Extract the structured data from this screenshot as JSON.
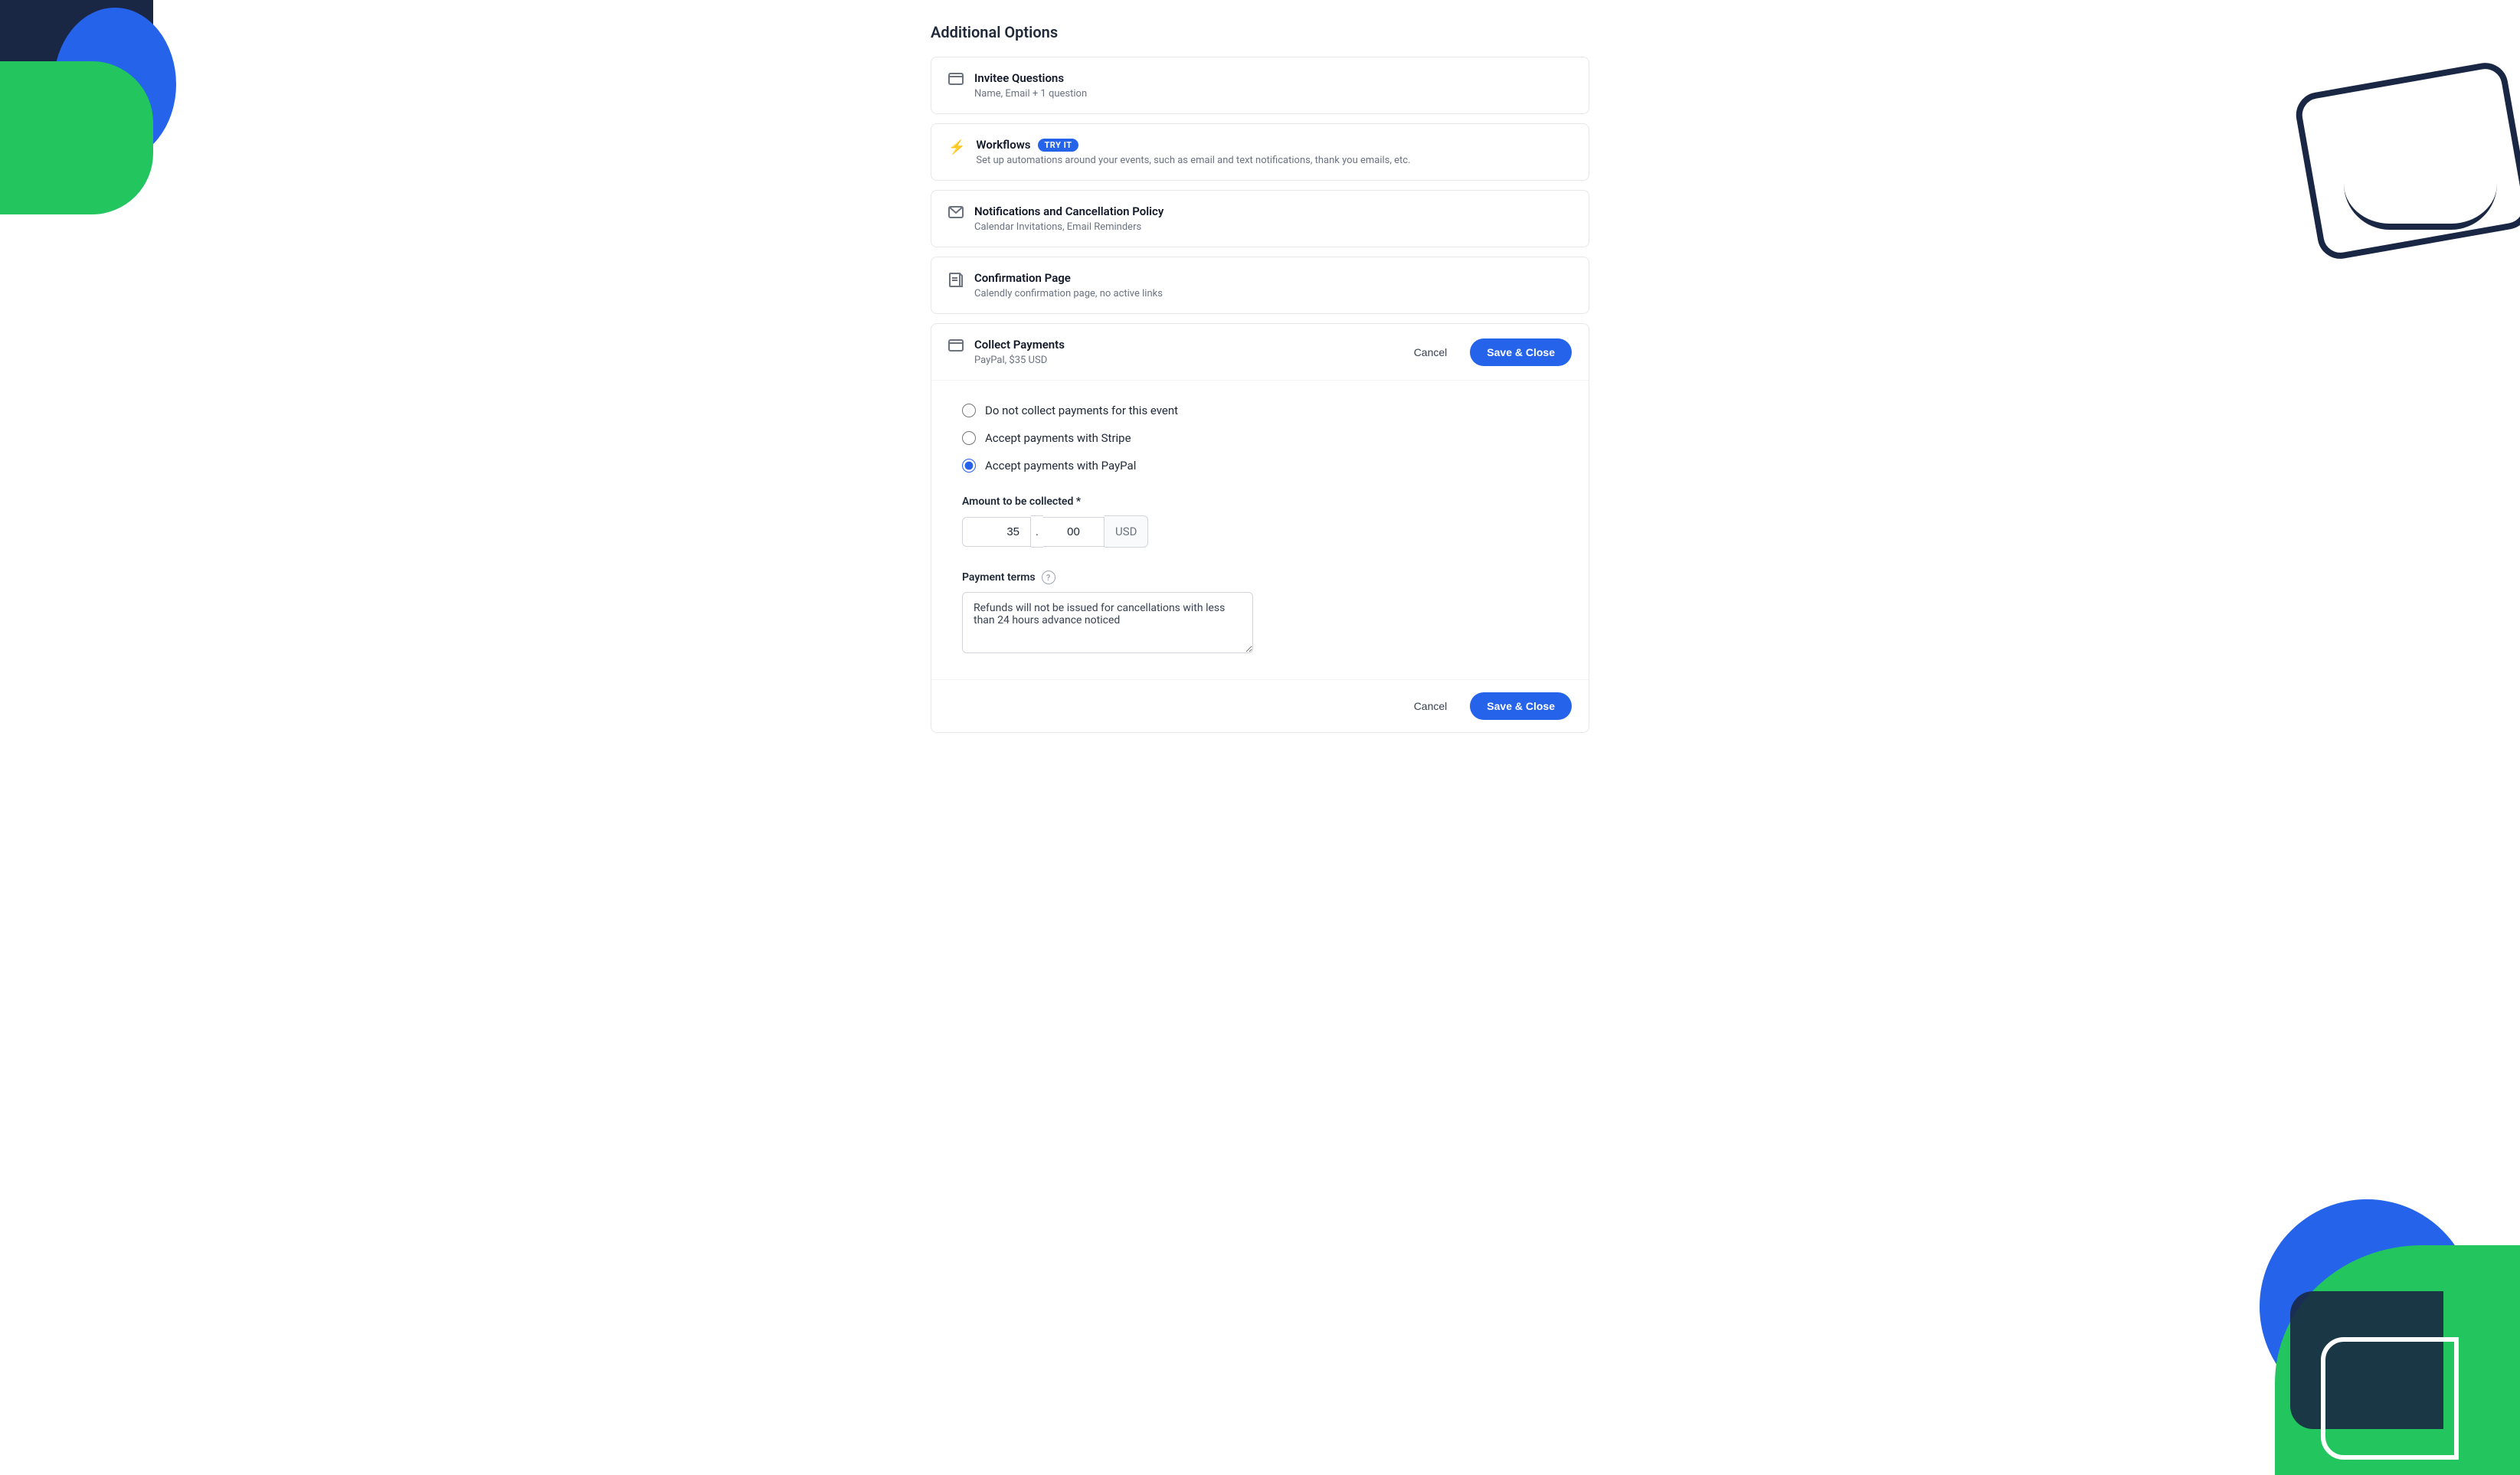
{
  "page": {
    "title": "Additional Options"
  },
  "options": [
    {
      "id": "invitee-questions",
      "icon": "card-icon",
      "title": "Invitee Questions",
      "subtitle": "Name, Email + 1 question",
      "badge": null
    },
    {
      "id": "workflows",
      "icon": "bolt-icon",
      "title": "Workflows",
      "subtitle": "Set up automations around your events, such as email and text notifications, thank you emails, etc.",
      "badge": "TRY IT"
    },
    {
      "id": "notifications",
      "icon": "mail-icon",
      "title": "Notifications and Cancellation Policy",
      "subtitle": "Calendar Invitations, Email Reminders",
      "badge": null
    },
    {
      "id": "confirmation",
      "icon": "page-icon",
      "title": "Confirmation Page",
      "subtitle": "Calendly confirmation page, no active links",
      "badge": null
    }
  ],
  "collect_payments": {
    "title": "Collect Payments",
    "subtitle": "PayPal, $35 USD",
    "cancel_label": "Cancel",
    "save_close_label": "Save & Close",
    "radio_options": [
      {
        "id": "no-payment",
        "label": "Do not collect payments for this event",
        "checked": false
      },
      {
        "id": "stripe",
        "label": "Accept payments with Stripe",
        "checked": false
      },
      {
        "id": "paypal",
        "label": "Accept payments with PayPal",
        "checked": true
      }
    ],
    "amount_label": "Amount to be collected *",
    "amount_dollars": "35",
    "amount_cents": "00",
    "currency": "USD",
    "payment_terms_label": "Payment terms",
    "payment_terms_value": "Refunds will not be issued for cancellations with less than 24 hours advance noticed",
    "footer_cancel_label": "Cancel",
    "footer_save_close_label": "Save & Close"
  }
}
